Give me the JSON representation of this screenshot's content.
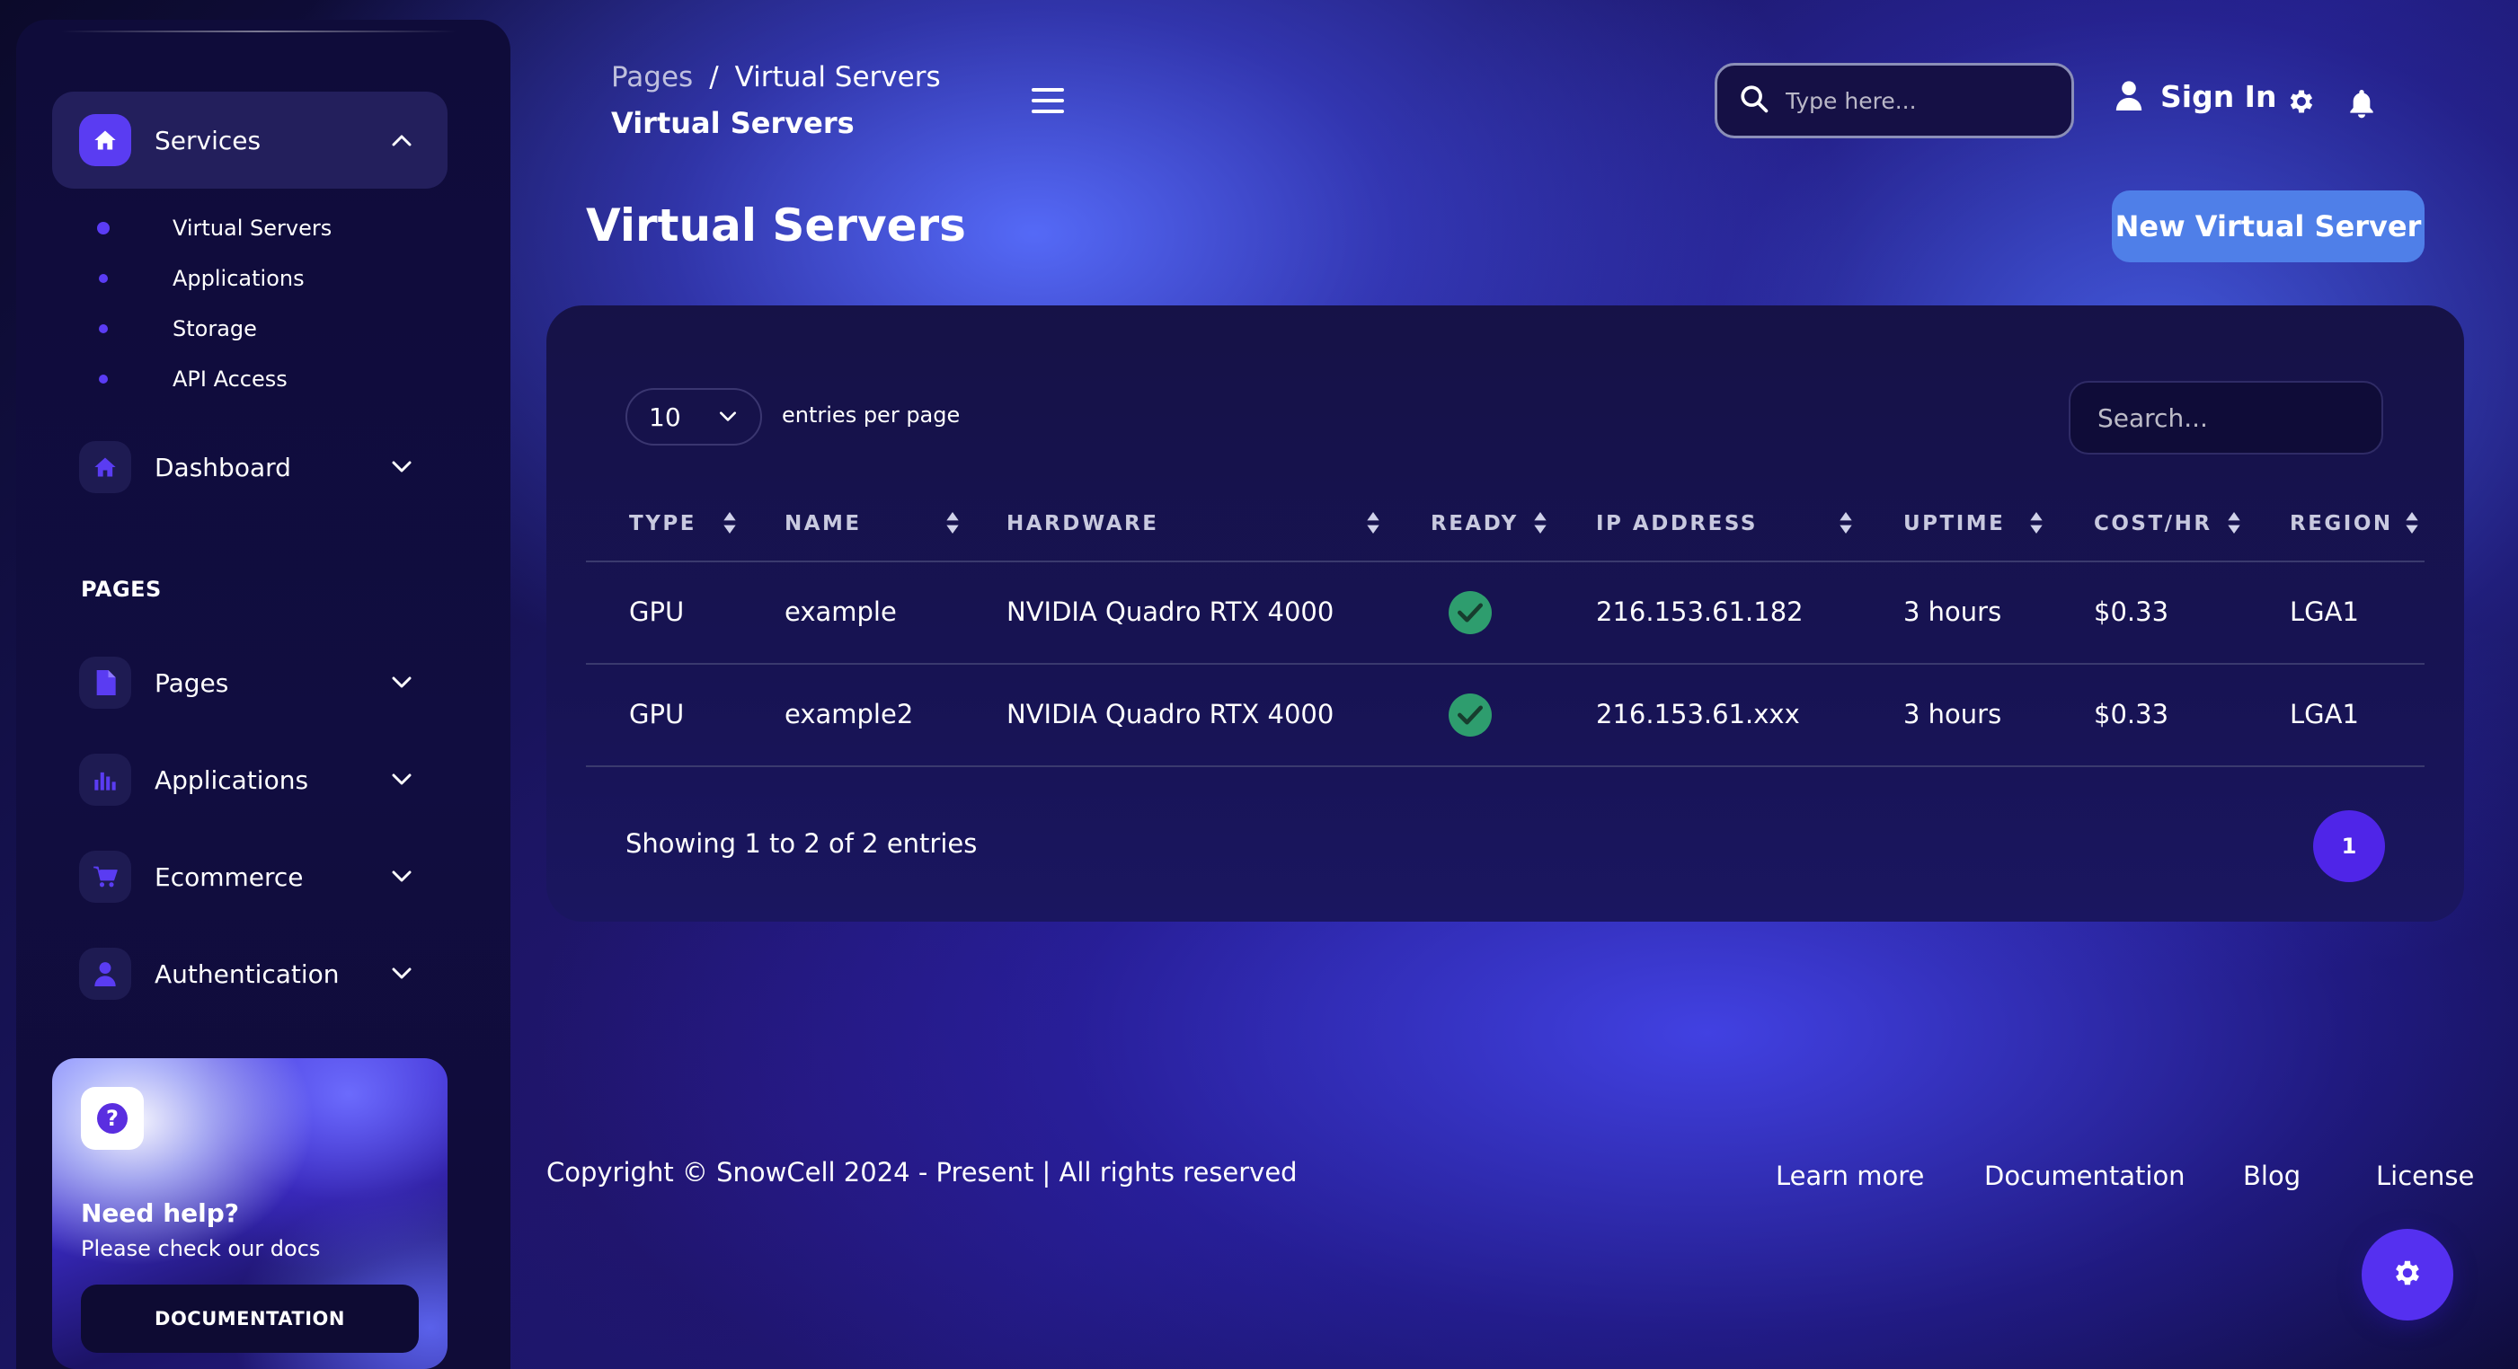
{
  "sidebar": {
    "services": {
      "label": "Services"
    },
    "service_items": [
      {
        "label": "Virtual Servers"
      },
      {
        "label": "Applications"
      },
      {
        "label": "Storage"
      },
      {
        "label": "API Access"
      }
    ],
    "dashboard": {
      "label": "Dashboard"
    },
    "section_title": "PAGES",
    "pages": {
      "label": "Pages"
    },
    "applications": {
      "label": "Applications"
    },
    "ecommerce": {
      "label": "Ecommerce"
    },
    "authentication": {
      "label": "Authentication"
    },
    "help": {
      "title": "Need help?",
      "subtitle": "Please check our docs",
      "button": "DOCUMENTATION"
    }
  },
  "header": {
    "breadcrumb": {
      "root": "Pages",
      "separator": "/",
      "current": "Virtual Servers"
    },
    "title": "Virtual Servers",
    "search_placeholder": "Type here...",
    "signin_label": "Sign In"
  },
  "main": {
    "title": "Virtual Servers",
    "new_button": "New Virtual Server",
    "table": {
      "entries_value": "10",
      "entries_label": "entries per page",
      "search_placeholder": "Search...",
      "columns": [
        "TYPE",
        "NAME",
        "HARDWARE",
        "READY",
        "IP ADDRESS",
        "UPTIME",
        "COST/HR",
        "REGION"
      ],
      "rows": [
        {
          "type": "GPU",
          "name": "example",
          "hardware": "NVIDIA Quadro RTX 4000",
          "ready": true,
          "ip": "216.153.61.182",
          "uptime": "3 hours",
          "cost": "$0.33",
          "region": "LGA1"
        },
        {
          "type": "GPU",
          "name": "example2",
          "hardware": "NVIDIA Quadro RTX 4000",
          "ready": true,
          "ip": "216.153.61.xxx",
          "uptime": "3 hours",
          "cost": "$0.33",
          "region": "LGA1"
        }
      ],
      "showing": "Showing 1 to 2 of 2 entries",
      "current_page": "1"
    }
  },
  "footer": {
    "copyright": "Copyright © SnowCell 2024 - Present | All rights reserved",
    "links": [
      "Learn more",
      "Documentation",
      "Blog",
      "License"
    ]
  },
  "icons": {
    "home": "home-icon",
    "file": "file-icon",
    "chart": "chart-icon",
    "cart": "cart-icon",
    "user": "user-icon",
    "search": "search-icon",
    "gear": "gear-icon",
    "bell": "bell-icon",
    "check": "check-icon",
    "sort": "sort-icon"
  },
  "colors": {
    "accent": "#5a3cf2",
    "primary_button": "#4f7fe8",
    "ready_green": "#2e9d6e",
    "sidebar_bg": "#0f0c3a",
    "card_bg": "#161247"
  }
}
